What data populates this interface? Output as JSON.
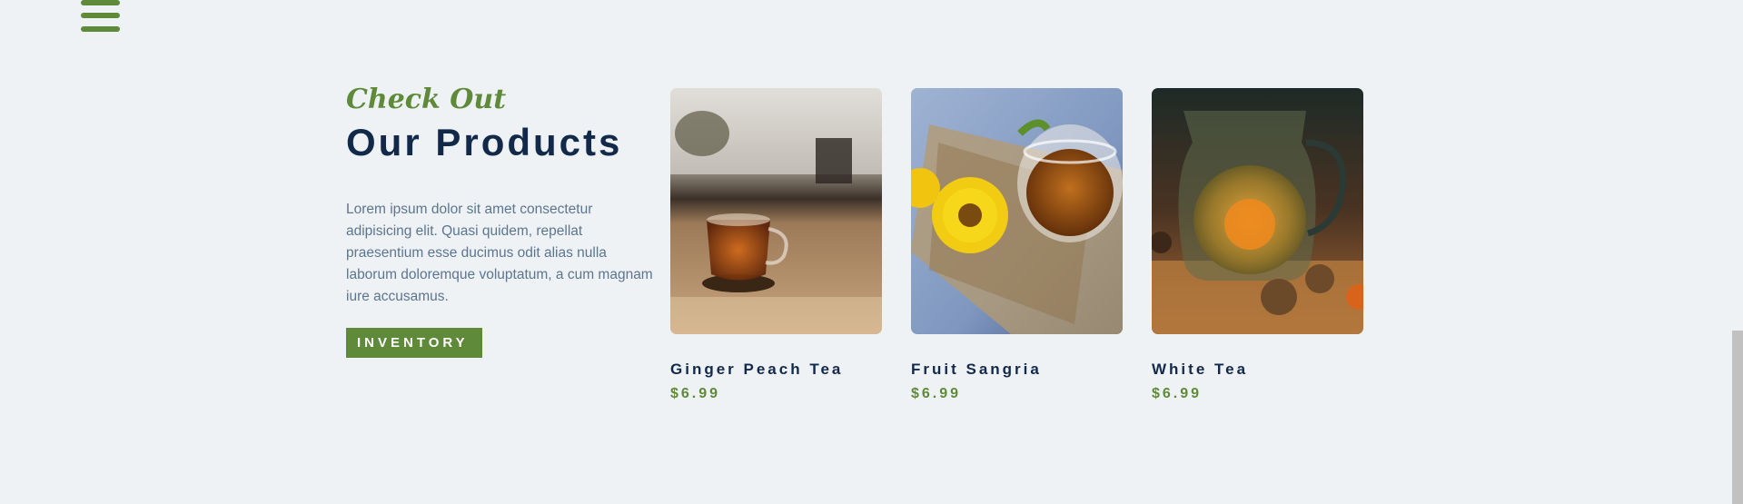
{
  "nav": {
    "menu_icon": "hamburger-menu-icon"
  },
  "intro": {
    "eyebrow": "Check Out",
    "title": "Our Products",
    "description": "Lorem ipsum dolor sit amet consectetur adipisicing elit. Quasi quidem, repellat praesentium esse ducimus odit alias nulla laborum doloremque voluptatum, a cum magnam iure accusamus.",
    "button_label": "INVENTORY"
  },
  "products": [
    {
      "name": "Ginger Peach Tea",
      "price": "$6.99"
    },
    {
      "name": "Fruit Sangria",
      "price": "$6.99"
    },
    {
      "name": "White Tea",
      "price": "$6.99"
    }
  ],
  "colors": {
    "accent": "#5f8a3a",
    "heading": "#13294a",
    "body_text": "#5c7590",
    "background": "#eef2f5"
  }
}
